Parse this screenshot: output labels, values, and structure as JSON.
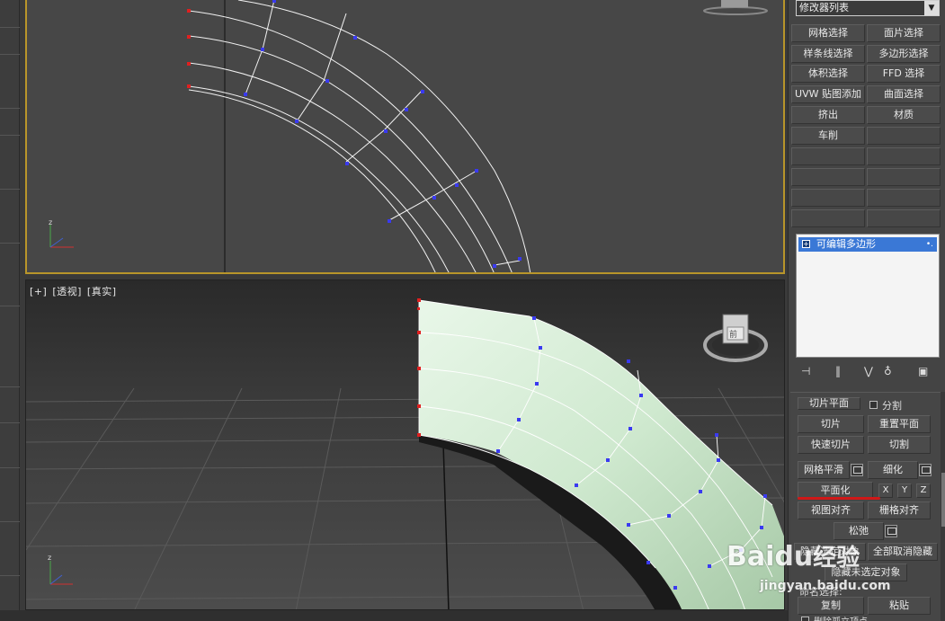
{
  "viewport_top": {
    "axis_z": "z",
    "axis_x": "x",
    "axis_y": "y"
  },
  "viewport_persp": {
    "label_plus": "[+]",
    "label_view": "[透视]",
    "label_shade": "[真实]",
    "axis_z": "z",
    "axis_x": "x",
    "axis_y": "y",
    "viewcube_text": "前"
  },
  "panel": {
    "modifier_list": "修改器列表",
    "modifier_buttons": [
      "网格选择",
      "面片选择",
      "样条线选择",
      "多边形选择",
      "体积选择",
      "FFD 选择",
      "UVW 贴图添加",
      "曲面选择",
      "挤出",
      "材质",
      "车削"
    ],
    "stack_item": "可编辑多边形",
    "rollout": {
      "slice_plane": "切片平面",
      "split": "分割",
      "slice": "切片",
      "reset_plane": "重置平面",
      "quick_slice": "快速切片",
      "cut": "切割",
      "meshsmooth": "网格平滑",
      "tessellate": "细化",
      "make_planar": "平面化",
      "x": "X",
      "y": "Y",
      "z": "Z",
      "view_align": "视图对齐",
      "grid_align": "栅格对齐",
      "relax": "松弛",
      "hide_selected": "隐藏选定对象",
      "unhide_all": "全部取消隐藏",
      "hide_unselected": "隐藏未选定对象",
      "named_selections": "命名选择:",
      "copy": "复制",
      "paste": "粘贴",
      "delete_isolated": "删除孤立顶点"
    }
  },
  "watermark": {
    "brand": "Baidu",
    "brand_cn": "经验",
    "url": "jingyan.baidu.com"
  },
  "colors": {
    "selection_border": "#b8952a",
    "mesh_color": "#cfe9cf",
    "vertex_blue": "#3a3af0",
    "vertex_red": "#e02020",
    "underline_red": "#d01818"
  }
}
